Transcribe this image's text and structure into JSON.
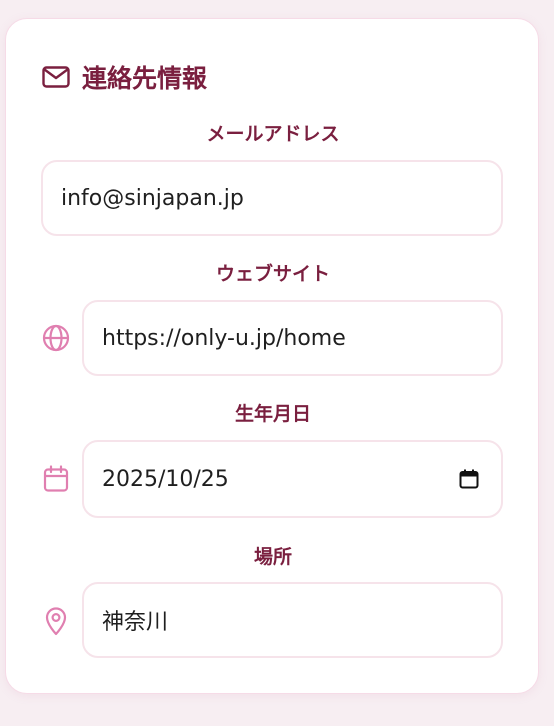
{
  "section": {
    "title": "連絡先情報",
    "icon": "mail-icon"
  },
  "email": {
    "label": "メールアドレス",
    "value": "info@sinjapan.jp"
  },
  "website": {
    "label": "ウェブサイト",
    "value": "https://only-u.jp/home",
    "icon": "globe-icon"
  },
  "birthday": {
    "label": "生年月日",
    "value": "2025/10/25",
    "icon": "calendar-icon"
  },
  "location": {
    "label": "場所",
    "value": "神奈川",
    "icon": "map-pin-icon"
  },
  "colors": {
    "accent": "#7a1f3f",
    "icon_pink": "#e07fb0",
    "border": "#f6e3ea"
  }
}
